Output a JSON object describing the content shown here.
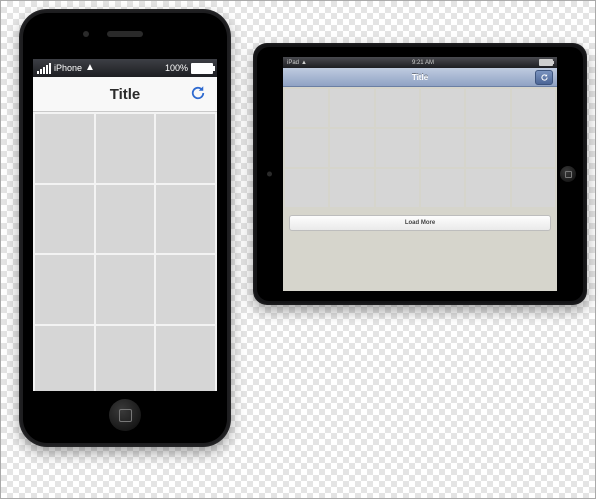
{
  "iphone": {
    "status": {
      "carrier": "iPhone",
      "battery_text": "100%",
      "battery_fill_pct": 100
    },
    "nav": {
      "title": "Title",
      "refresh_icon": "refresh-icon"
    },
    "grid": {
      "columns": 3,
      "rows": 4
    }
  },
  "ipad": {
    "status": {
      "carrier": "iPad",
      "time": "9:21 AM",
      "battery_fill_pct": 100
    },
    "nav": {
      "title": "Title",
      "refresh_icon": "refresh-icon"
    },
    "grid": {
      "columns": 6,
      "rows": 3
    },
    "load_more_label": "Load More"
  }
}
